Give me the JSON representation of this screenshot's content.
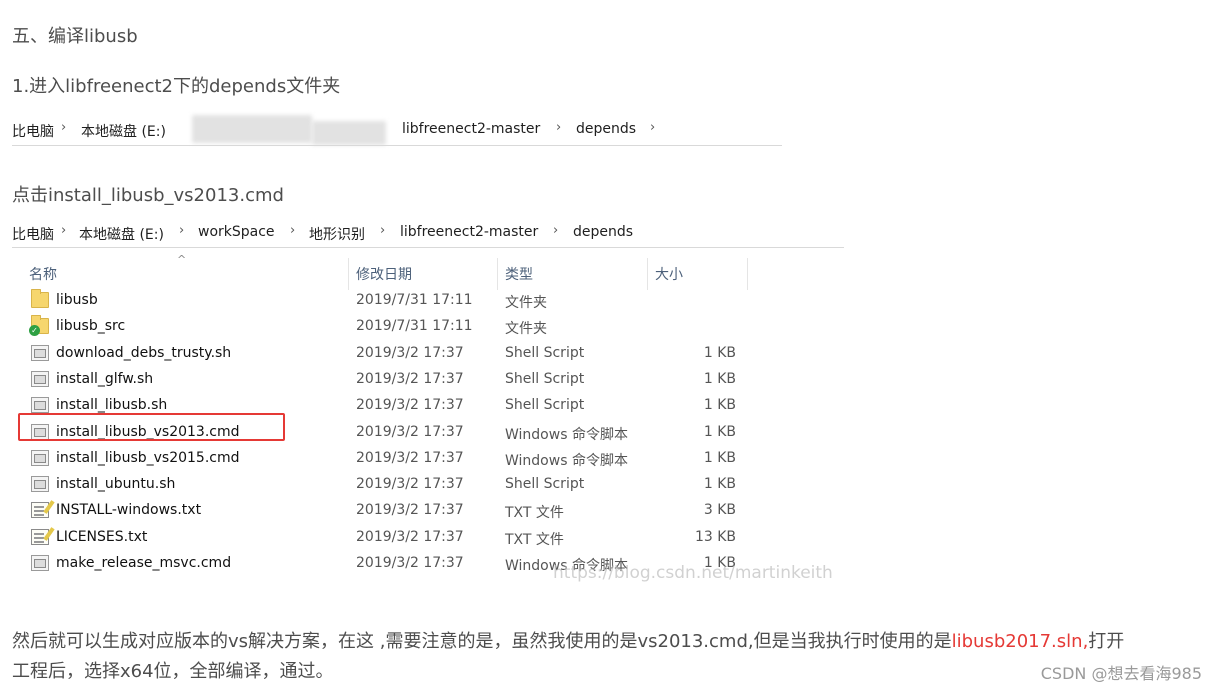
{
  "heading": "五、编译libusb",
  "step1": "1.进入libfreenect2下的depends文件夹",
  "breadcrumb1": [
    "比电脑",
    "本地磁盘 (E:)",
    "libfreenect2-master",
    "depends"
  ],
  "click_text": "点击install_libusb_vs2013.cmd",
  "breadcrumb2": [
    "比电脑",
    "本地磁盘 (E:)",
    "workSpace",
    "地形识别",
    "libfreenect2-master",
    "depends"
  ],
  "columns": {
    "name": "名称",
    "date": "修改日期",
    "type": "类型",
    "size": "大小"
  },
  "files": [
    {
      "name": "libusb",
      "date": "2019/7/31 17:11",
      "type": "文件夹",
      "size": "",
      "icon": "folder-icon"
    },
    {
      "name": "libusb_src",
      "date": "2019/7/31 17:11",
      "type": "文件夹",
      "size": "",
      "icon": "synced-folder-icon"
    },
    {
      "name": "download_debs_trusty.sh",
      "date": "2019/3/2 17:37",
      "type": "Shell Script",
      "size": "1 KB",
      "icon": "script-icon"
    },
    {
      "name": "install_glfw.sh",
      "date": "2019/3/2 17:37",
      "type": "Shell Script",
      "size": "1 KB",
      "icon": "script-icon"
    },
    {
      "name": "install_libusb.sh",
      "date": "2019/3/2 17:37",
      "type": "Shell Script",
      "size": "1 KB",
      "icon": "script-icon"
    },
    {
      "name": "install_libusb_vs2013.cmd",
      "date": "2019/3/2 17:37",
      "type": "Windows 命令脚本",
      "size": "1 KB",
      "icon": "script-icon"
    },
    {
      "name": "install_libusb_vs2015.cmd",
      "date": "2019/3/2 17:37",
      "type": "Windows 命令脚本",
      "size": "1 KB",
      "icon": "script-icon"
    },
    {
      "name": "install_ubuntu.sh",
      "date": "2019/3/2 17:37",
      "type": "Shell Script",
      "size": "1 KB",
      "icon": "script-icon"
    },
    {
      "name": "INSTALL-windows.txt",
      "date": "2019/3/2 17:37",
      "type": "TXT 文件",
      "size": "3 KB",
      "icon": "text-file-icon"
    },
    {
      "name": "LICENSES.txt",
      "date": "2019/3/2 17:37",
      "type": "TXT 文件",
      "size": "13 KB",
      "icon": "text-file-icon"
    },
    {
      "name": "make_release_msvc.cmd",
      "date": "2019/3/2 17:37",
      "type": "Windows 命令脚本",
      "size": "1 KB",
      "icon": "script-icon"
    }
  ],
  "watermark": "https://blog.csdn.net/martinkeith",
  "body_text": {
    "part1": "然后就可以生成对应版本的vs解决方案，在这 ,需要注意的是，虽然我使用的是vs2013.cmd,但是当我执行时使用的是",
    "highlight": "libusb2017.sln,",
    "part2": "打开",
    "line2": "工程后，选择x64位，全部编译，通过。"
  },
  "csdn_credit": "CSDN @想去看海985",
  "colors": {
    "highlight_red": "#e53935",
    "header_blue": "#4c607a"
  }
}
